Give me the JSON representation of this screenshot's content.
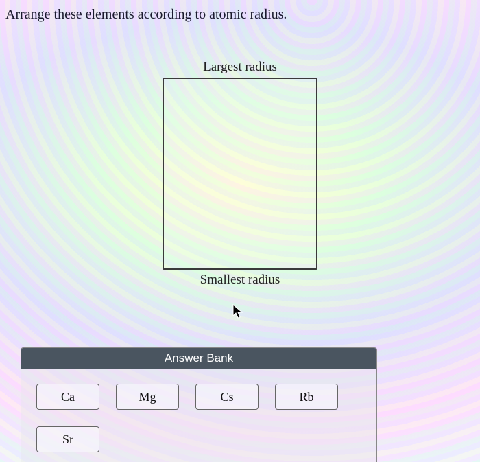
{
  "question": "Arrange these elements according to atomic radius.",
  "labels": {
    "top": "Largest radius",
    "bottom": "Smallest radius"
  },
  "bank": {
    "header": "Answer Bank",
    "items": [
      "Ca",
      "Mg",
      "Cs",
      "Rb",
      "Sr"
    ]
  }
}
